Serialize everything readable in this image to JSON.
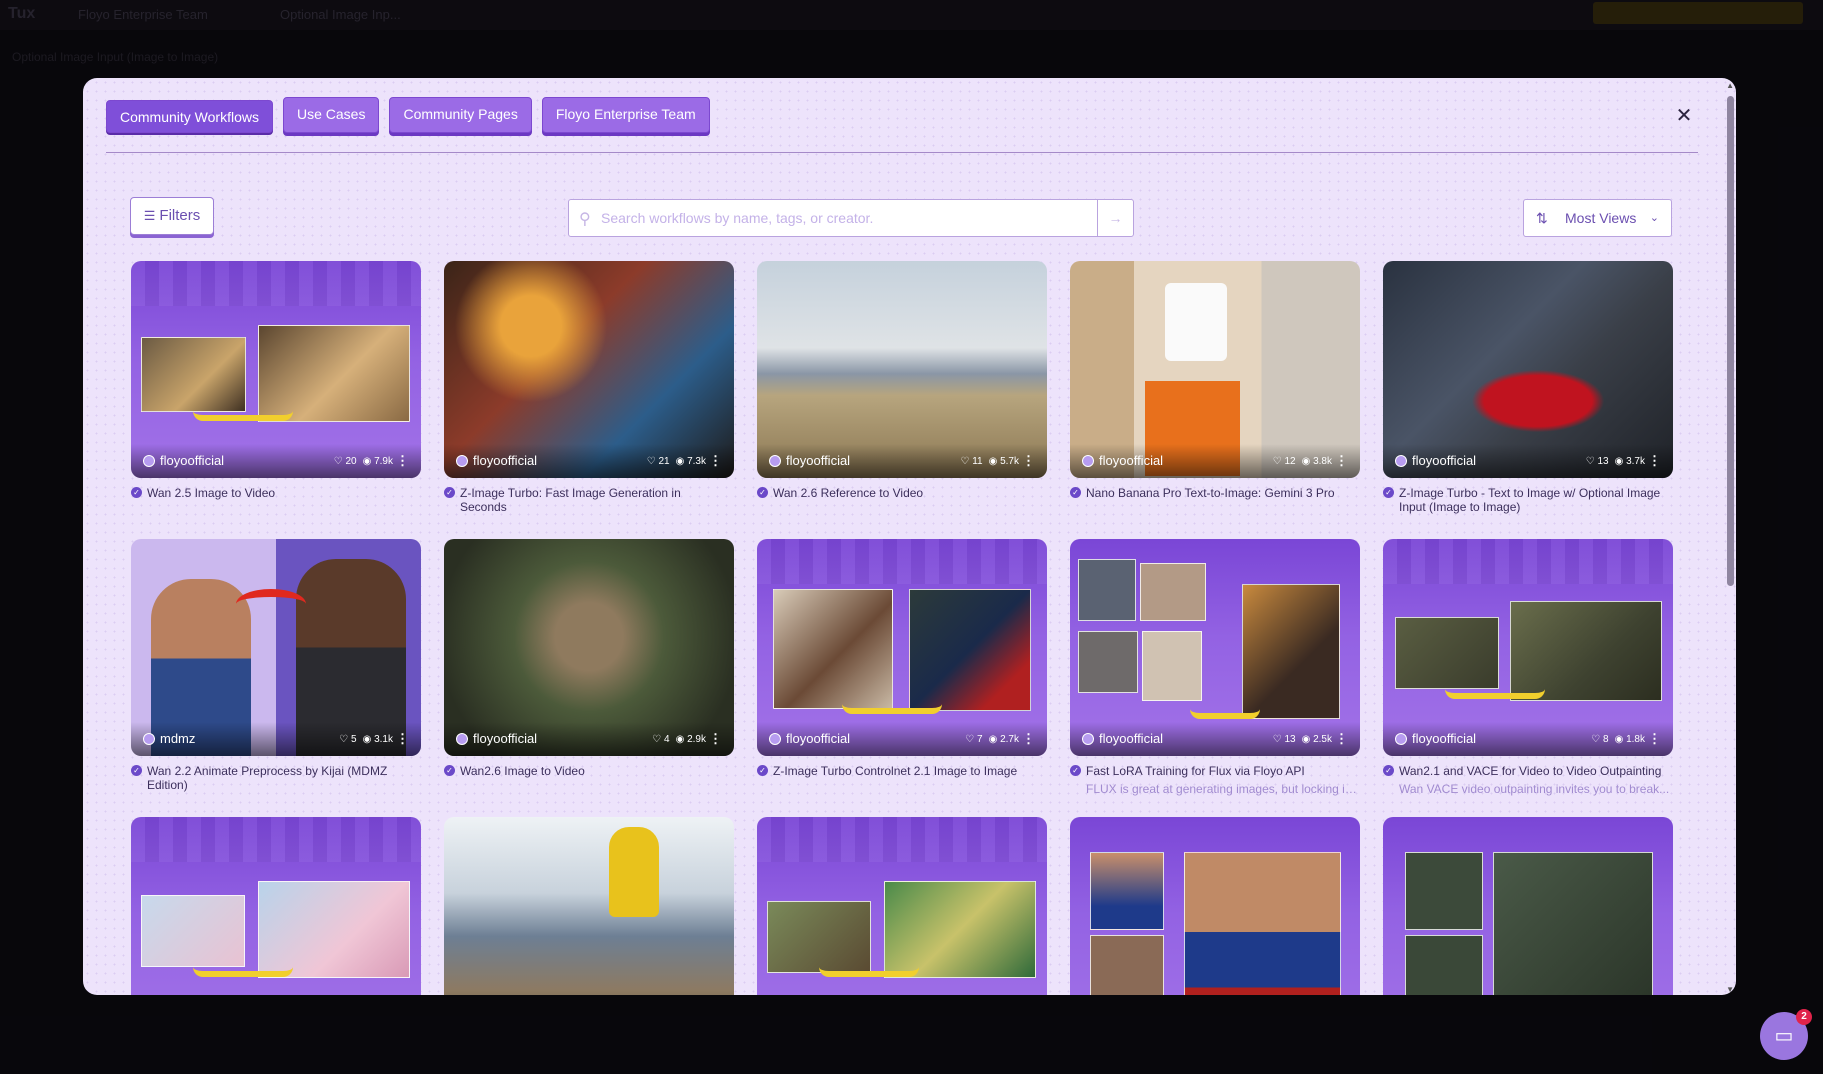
{
  "background_app": {
    "logo": "Tux",
    "tabs": [
      "Floyo Enterprise Team",
      "Optional Image Inp..."
    ],
    "subtitle": "Optional Image Input (Image to Image)"
  },
  "modal": {
    "tabs": [
      {
        "label": "Community Workflows",
        "active": true
      },
      {
        "label": "Use Cases",
        "active": false
      },
      {
        "label": "Community Pages",
        "active": false
      },
      {
        "label": "Floyo Enterprise Team",
        "active": false
      }
    ],
    "close_icon": "close-icon",
    "filters_label": "Filters",
    "search": {
      "placeholder": "Search workflows by name, tags, or creator.",
      "value": ""
    },
    "sort": {
      "label": "Most Views"
    }
  },
  "cards": [
    {
      "author": "floyoofficial",
      "likes": "20",
      "views": "7.9k",
      "title": "Wan 2.5 Image to Video",
      "desc": ""
    },
    {
      "author": "floyoofficial",
      "likes": "21",
      "views": "7.3k",
      "title": "Z-Image Turbo: Fast Image Generation in Seconds",
      "desc": ""
    },
    {
      "author": "floyoofficial",
      "likes": "11",
      "views": "5.7k",
      "title": "Wan 2.6 Reference to Video",
      "desc": ""
    },
    {
      "author": "floyoofficial",
      "likes": "12",
      "views": "3.8k",
      "title": "Nano Banana Pro Text-to-Image: Gemini 3 Pro",
      "desc": ""
    },
    {
      "author": "floyoofficial",
      "likes": "13",
      "views": "3.7k",
      "title": "Z-Image Turbo - Text to Image w/ Optional Image Input (Image to Image)",
      "desc": ""
    },
    {
      "author": "mdmz",
      "likes": "5",
      "views": "3.1k",
      "title": "Wan 2.2 Animate Preprocess by Kijai (MDMZ Edition)",
      "desc": ""
    },
    {
      "author": "floyoofficial",
      "likes": "4",
      "views": "2.9k",
      "title": "Wan2.6 Image to Video",
      "desc": ""
    },
    {
      "author": "floyoofficial",
      "likes": "7",
      "views": "2.7k",
      "title": "Z-Image Turbo Controlnet 2.1 Image to Image",
      "desc": ""
    },
    {
      "author": "floyoofficial",
      "likes": "13",
      "views": "2.5k",
      "title": "Fast LoRA Training for Flux via Floyo API",
      "desc": "FLUX is great at generating images, but locking in..."
    },
    {
      "author": "floyoofficial",
      "likes": "8",
      "views": "1.8k",
      "title": "Wan2.1 and VACE for Video to Video Outpainting",
      "desc": "Wan VACE video outpainting invites you to break..."
    },
    {
      "author": "",
      "likes": "",
      "views": "",
      "title": "",
      "desc": ""
    },
    {
      "author": "",
      "likes": "",
      "views": "",
      "title": "",
      "desc": ""
    },
    {
      "author": "",
      "likes": "",
      "views": "",
      "title": "",
      "desc": ""
    },
    {
      "author": "",
      "likes": "",
      "views": "",
      "title": "",
      "desc": ""
    },
    {
      "author": "",
      "likes": "",
      "views": "",
      "title": "",
      "desc": ""
    }
  ],
  "chat": {
    "badge": "2"
  },
  "colors": {
    "accent": "#7f4fd9",
    "modal_bg": "#ede3fb",
    "arrow": "#f1cf2d"
  }
}
